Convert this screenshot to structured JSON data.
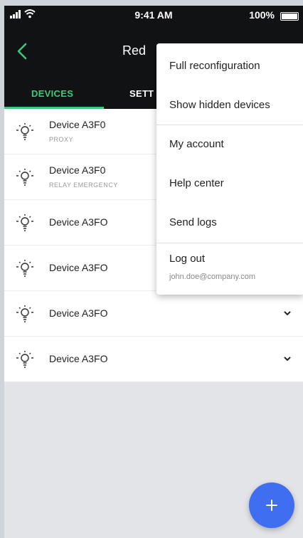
{
  "status": {
    "time": "9:41 AM",
    "battery": "100%"
  },
  "header": {
    "title": "Red"
  },
  "tabs": [
    {
      "label": "DEVICES"
    },
    {
      "label": "SETT"
    }
  ],
  "devices": [
    {
      "name": "Device A3F0",
      "subtitle": "PROXY"
    },
    {
      "name": "Device A3F0",
      "subtitle": "RELAY  EMERGENCY"
    },
    {
      "name": "Device A3FO"
    },
    {
      "name": "Device A3FO"
    },
    {
      "name": "Device A3FO"
    },
    {
      "name": "Device A3FO"
    }
  ],
  "menu": {
    "full_reconfiguration": "Full reconfiguration",
    "show_hidden_devices": "Show hidden devices",
    "my_account": "My account",
    "help_center": "Help center",
    "send_logs": "Send logs",
    "log_out": "Log out",
    "email": "john.doe@company.com"
  },
  "colors": {
    "accent": "#3ec97a",
    "fab": "#3f6ff0",
    "header": "#111214"
  },
  "icons": {
    "back": "chevron-left-icon",
    "device": "bulb-icon",
    "expand": "chevron-down-icon",
    "fab": "plus-icon"
  }
}
